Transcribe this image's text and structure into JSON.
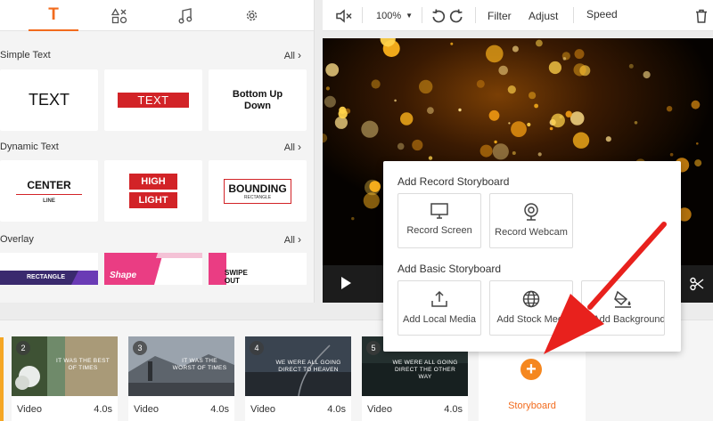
{
  "colors": {
    "accent": "#f26b1d",
    "red_text_style": "#d22327",
    "arrow": "#e8211d"
  },
  "left_tabs": [
    {
      "icon": "text-T-icon",
      "active": true
    },
    {
      "icon": "elements-shapes-icon",
      "active": false
    },
    {
      "icon": "music-note-icon",
      "active": false
    },
    {
      "icon": "settings-gear-icon",
      "active": false
    }
  ],
  "simple_text": {
    "title": "Simple Text",
    "all_label": "All",
    "items": [
      {
        "line1": "TEXT"
      },
      {
        "line1": "TEXT"
      },
      {
        "line1": "Bottom Up",
        "line2": "Down"
      }
    ]
  },
  "dynamic_text": {
    "title": "Dynamic Text",
    "all_label": "All",
    "items": [
      {
        "line1": "CENTER",
        "line2": "LINE"
      },
      {
        "line1": "HIGH",
        "line2": "LIGHT"
      },
      {
        "line1": "BOUNDING",
        "line2": "RECTANGLE"
      }
    ]
  },
  "overlay": {
    "title": "Overlay",
    "all_label": "All",
    "items": [
      {
        "text": "RECTANGLE"
      },
      {
        "text": "Shape"
      },
      {
        "text": "SWIPE",
        "text2": "OUT"
      }
    ]
  },
  "toolbar": {
    "zoom": "100%",
    "filter_label": "Filter",
    "adjust_label": "Adjust",
    "speed_label": "Speed"
  },
  "popup": {
    "record_title": "Add Record Storyboard",
    "record_options": [
      {
        "icon": "monitor-icon",
        "label": "Record Screen"
      },
      {
        "icon": "webcam-icon",
        "label": "Record Webcam"
      }
    ],
    "basic_title": "Add Basic Storyboard",
    "basic_options": [
      {
        "icon": "upload-icon",
        "label": "Add Local Media"
      },
      {
        "icon": "globe-icon",
        "label": "Add Stock Media"
      },
      {
        "icon": "paint-bucket-icon",
        "label": "Add Background"
      }
    ]
  },
  "timeline": {
    "clips": [
      {
        "number": "2",
        "caption": "IT WAS THE BEST OF TIMES",
        "type": "Video",
        "duration": "4.0s"
      },
      {
        "number": "3",
        "caption": "IT WAS THE WORST OF TIMES",
        "type": "Video",
        "duration": "4.0s"
      },
      {
        "number": "4",
        "caption": "WE WERE ALL GOING DIRECT TO HEAVEN",
        "type": "Video",
        "duration": "4.0s"
      },
      {
        "number": "5",
        "caption": "WE WERE ALL GOING DIRECT THE OTHER WAY",
        "type": "Video",
        "duration": "4.0s"
      }
    ],
    "storyboard_label": "Storyboard"
  }
}
